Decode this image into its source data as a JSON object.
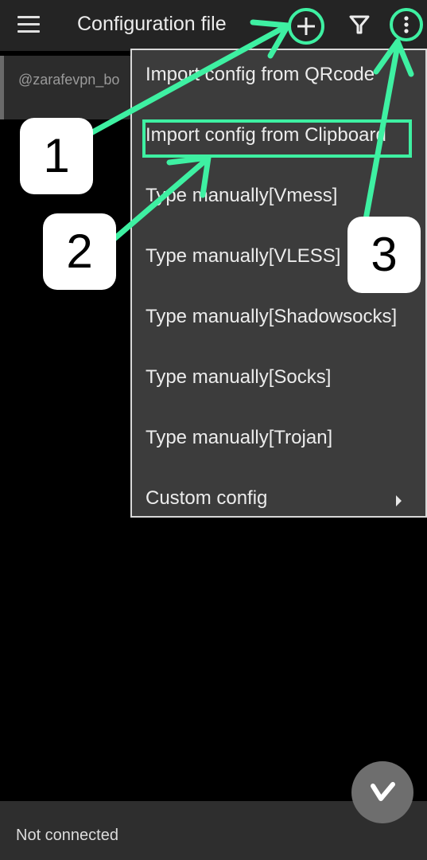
{
  "appbar": {
    "title": "Configuration file",
    "icons": [
      "menu-icon",
      "add-icon",
      "filter-icon",
      "more-vert-icon"
    ]
  },
  "server_list": {
    "items": [
      {
        "name": "@zarafevpn_bo"
      }
    ]
  },
  "dropdown_menu": {
    "items": [
      {
        "label": "Import config from QRcode",
        "highlighted": false,
        "submenu": false
      },
      {
        "label": "Import config from Clipboard",
        "highlighted": true,
        "submenu": false
      },
      {
        "label": "Type manually[Vmess]",
        "highlighted": false,
        "submenu": false
      },
      {
        "label": "Type manually[VLESS]",
        "highlighted": false,
        "submenu": false
      },
      {
        "label": "Type manually[Shadowsocks]",
        "highlighted": false,
        "submenu": false
      },
      {
        "label": "Type manually[Socks]",
        "highlighted": false,
        "submenu": false
      },
      {
        "label": "Type manually[Trojan]",
        "highlighted": false,
        "submenu": false
      },
      {
        "label": "Custom config",
        "highlighted": false,
        "submenu": true
      }
    ]
  },
  "callouts": [
    {
      "number": "1"
    },
    {
      "number": "2"
    },
    {
      "number": "3"
    }
  ],
  "status": {
    "text": "Not connected"
  },
  "colors": {
    "annotation": "#3ef0a2",
    "appbar": "#242424",
    "menu_bg": "#3c3c3c",
    "fab": "#6e6e6e"
  }
}
